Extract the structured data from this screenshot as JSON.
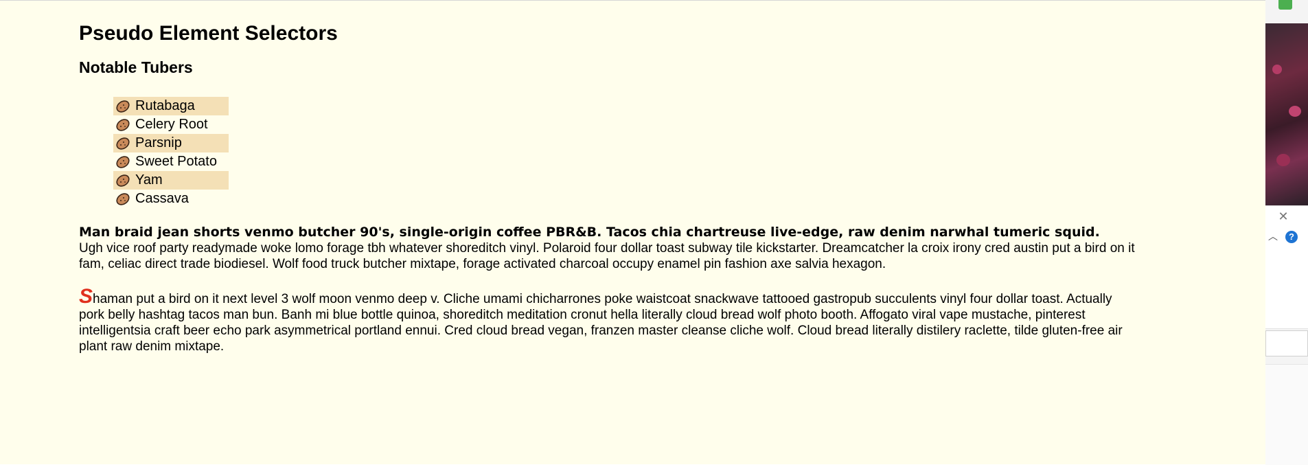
{
  "page": {
    "title": "Pseudo Element Selectors",
    "subtitle": "Notable Tubers"
  },
  "tubers": [
    {
      "label": "Rutabaga",
      "icon": "potato-icon"
    },
    {
      "label": "Celery Root",
      "icon": "potato-icon"
    },
    {
      "label": "Parsnip",
      "icon": "potato-icon"
    },
    {
      "label": "Sweet Potato",
      "icon": "potato-icon"
    },
    {
      "label": "Yam",
      "icon": "potato-icon"
    },
    {
      "label": "Cassava",
      "icon": "potato-icon"
    }
  ],
  "paragraph1": {
    "first_line": "Man braid jean shorts venmo butcher 90's, single-origin coffee PBR&B. Tacos chia chartreuse live-edge, raw denim narwhal tumeric squid.",
    "rest": "Ugh vice roof party readymade woke lomo forage tbh whatever shoreditch vinyl. Polaroid four dollar toast subway tile kickstarter. Dreamcatcher la croix irony cred austin put a bird on it fam, celiac direct trade biodiesel. Wolf food truck butcher mixtape, forage activated charcoal occupy enamel pin fashion axe salvia hexagon."
  },
  "paragraph2": {
    "first_letter": "S",
    "rest": "haman put a bird on it next level 3 wolf moon venmo deep v. Cliche umami chicharrones poke waistcoat snackwave tattooed gastropub succulents vinyl four dollar toast. Actually pork belly hashtag tacos man bun. Banh mi blue bottle quinoa, shoreditch meditation cronut hella literally cloud bread wolf photo booth. Affogato viral vape mustache, pinterest intelligentsia craft beer echo park asymmetrical portland ennui. Cred cloud bread vegan, franzen master cleanse cliche wolf. Cloud bread literally distilery raclette, tilde gluten-free air plant raw denim mixtape."
  },
  "side_panel": {
    "close_glyph": "✕",
    "chevron_glyph": "︿",
    "help_glyph": "?"
  },
  "colors": {
    "page_background": "#fffeec",
    "list_highlight": "#f4e0b6",
    "first_letter": "#e0301e",
    "help_badge": "#1e74d3"
  }
}
